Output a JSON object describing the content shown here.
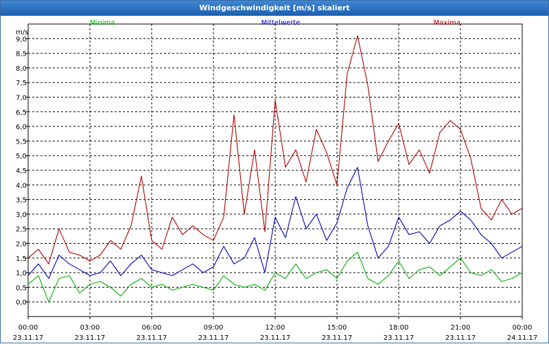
{
  "window": {
    "title": "Windgeschwindigkeit [m/s] skaliert"
  },
  "chart_data": {
    "type": "line",
    "title": "Windgeschwindigkeit [m/s] skaliert",
    "ylabel": "m/s",
    "ylim": [
      -0.5,
      9.5
    ],
    "yticks": [
      "0,0",
      "0,5",
      "1,0",
      "1,5",
      "2,0",
      "2,5",
      "3,0",
      "3,5",
      "4,0",
      "4,5",
      "5,0",
      "5,5",
      "6,0",
      "6,5",
      "7,0",
      "7,5",
      "8,0",
      "8,5",
      "9,0"
    ],
    "x_ticks": [
      {
        "time": "00:00",
        "date": "23.11.17"
      },
      {
        "time": "03:00",
        "date": "23.11.17"
      },
      {
        "time": "06:00",
        "date": "23.11.17"
      },
      {
        "time": "09:00",
        "date": "23.11.17"
      },
      {
        "time": "12:00",
        "date": "23.11.17"
      },
      {
        "time": "15:00",
        "date": "23.11.17"
      },
      {
        "time": "18:00",
        "date": "23.11.17"
      },
      {
        "time": "21:00",
        "date": "23.11.17"
      },
      {
        "time": "00:00",
        "date": "24.11.17"
      }
    ],
    "x_hours": [
      0,
      0.5,
      1,
      1.5,
      2,
      2.5,
      3,
      3.5,
      4,
      4.5,
      5,
      5.5,
      6,
      6.5,
      7,
      7.5,
      8,
      8.5,
      9,
      9.5,
      10,
      10.5,
      11,
      11.5,
      12,
      12.5,
      13,
      13.5,
      14,
      14.5,
      15,
      15.5,
      16,
      16.5,
      17,
      17.5,
      18,
      18.5,
      19,
      19.5,
      20,
      20.5,
      21,
      21.5,
      22,
      22.5,
      23,
      23.5,
      24
    ],
    "grid": true,
    "legend_position": "top",
    "series": [
      {
        "name": "Minima",
        "color": "#00b000",
        "values": [
          0.6,
          0.9,
          0.0,
          0.8,
          0.9,
          0.3,
          0.6,
          0.7,
          0.5,
          0.2,
          0.6,
          0.8,
          0.5,
          0.6,
          0.4,
          0.5,
          0.6,
          0.5,
          0.4,
          0.9,
          0.6,
          0.5,
          0.6,
          0.4,
          1.0,
          0.8,
          1.3,
          0.8,
          1.0,
          1.1,
          0.8,
          1.4,
          1.7,
          0.8,
          0.6,
          0.9,
          1.4,
          0.8,
          1.1,
          1.2,
          0.9,
          1.2,
          1.5,
          1.0,
          0.9,
          1.1,
          0.7,
          0.8,
          1.0
        ]
      },
      {
        "name": "Mittelwerte",
        "color": "#0000c0",
        "values": [
          0.9,
          1.3,
          0.8,
          1.6,
          1.3,
          1.1,
          0.9,
          1.0,
          1.4,
          0.9,
          1.3,
          1.6,
          1.1,
          1.0,
          0.9,
          1.1,
          1.3,
          1.0,
          1.2,
          1.9,
          1.3,
          1.5,
          2.2,
          1.0,
          2.9,
          2.2,
          3.6,
          2.5,
          3.0,
          2.1,
          2.7,
          3.9,
          4.6,
          2.6,
          1.5,
          1.9,
          2.9,
          2.3,
          2.4,
          2.0,
          2.6,
          2.8,
          3.1,
          2.8,
          2.3,
          2.0,
          1.5,
          1.7,
          1.9
        ]
      },
      {
        "name": "Maxima",
        "color": "#b00000",
        "values": [
          1.5,
          1.8,
          1.3,
          2.5,
          1.7,
          1.6,
          1.4,
          1.6,
          2.1,
          1.8,
          2.6,
          4.3,
          2.1,
          1.8,
          2.9,
          2.3,
          2.6,
          2.3,
          2.1,
          2.9,
          6.4,
          3.0,
          5.2,
          2.4,
          6.9,
          4.6,
          5.2,
          4.1,
          5.9,
          5.1,
          4.0,
          7.8,
          9.1,
          7.4,
          4.8,
          5.5,
          6.1,
          4.7,
          5.2,
          4.4,
          5.8,
          6.2,
          5.9,
          4.9,
          3.2,
          2.8,
          3.5,
          3.0,
          3.2
        ]
      }
    ]
  }
}
